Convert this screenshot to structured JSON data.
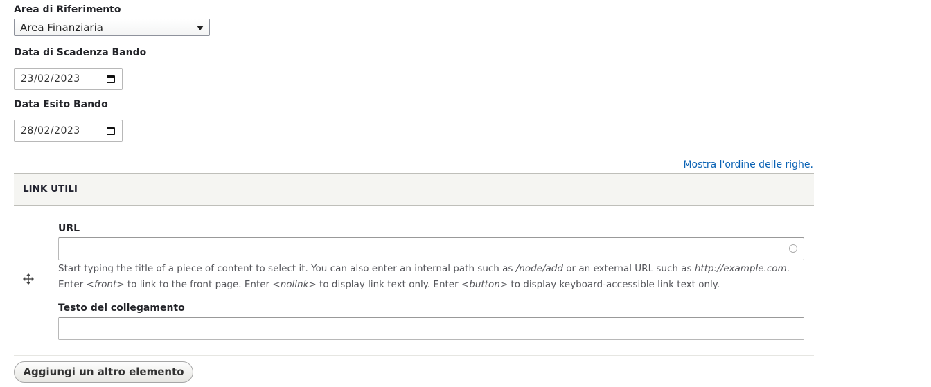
{
  "area_riferimento": {
    "label": "Area di Riferimento",
    "selected": "Area Finanziaria"
  },
  "data_scadenza": {
    "label": "Data di Scadenza Bando",
    "value": "23/02/2023"
  },
  "data_esito": {
    "label": "Data Esito Bando",
    "value": "28/02/2023"
  },
  "order_link": "Mostra l'ordine delle righe.",
  "link_utili": {
    "header": "LINK UTILI",
    "url_label": "URL",
    "url_value": "",
    "help": {
      "part1": "Start typing the title of a piece of content to select it. You can also enter an internal path such as ",
      "node_add": "/node/add",
      "part2": " or an external URL such as ",
      "example_url": "http://example.com",
      "part3": ".",
      "part4": "Enter ",
      "front": "<front>",
      "part5": " to link to the front page. Enter ",
      "nolink": "<nolink>",
      "part6": " to display link text only. Enter ",
      "button": "<button>",
      "part7": " to display keyboard-accessible link text only."
    },
    "text_label": "Testo del collegamento",
    "text_value": ""
  },
  "add_button": "Aggiungi un altro elemento",
  "icons": {
    "drag": "drag-handle-icon",
    "calendar": "calendar-icon",
    "dropdown": "chevron-down-icon",
    "autocomplete": "autocomplete-throbber-icon"
  },
  "colors": {
    "link": "#0a62b4",
    "header_bg": "#f5f5f2"
  }
}
